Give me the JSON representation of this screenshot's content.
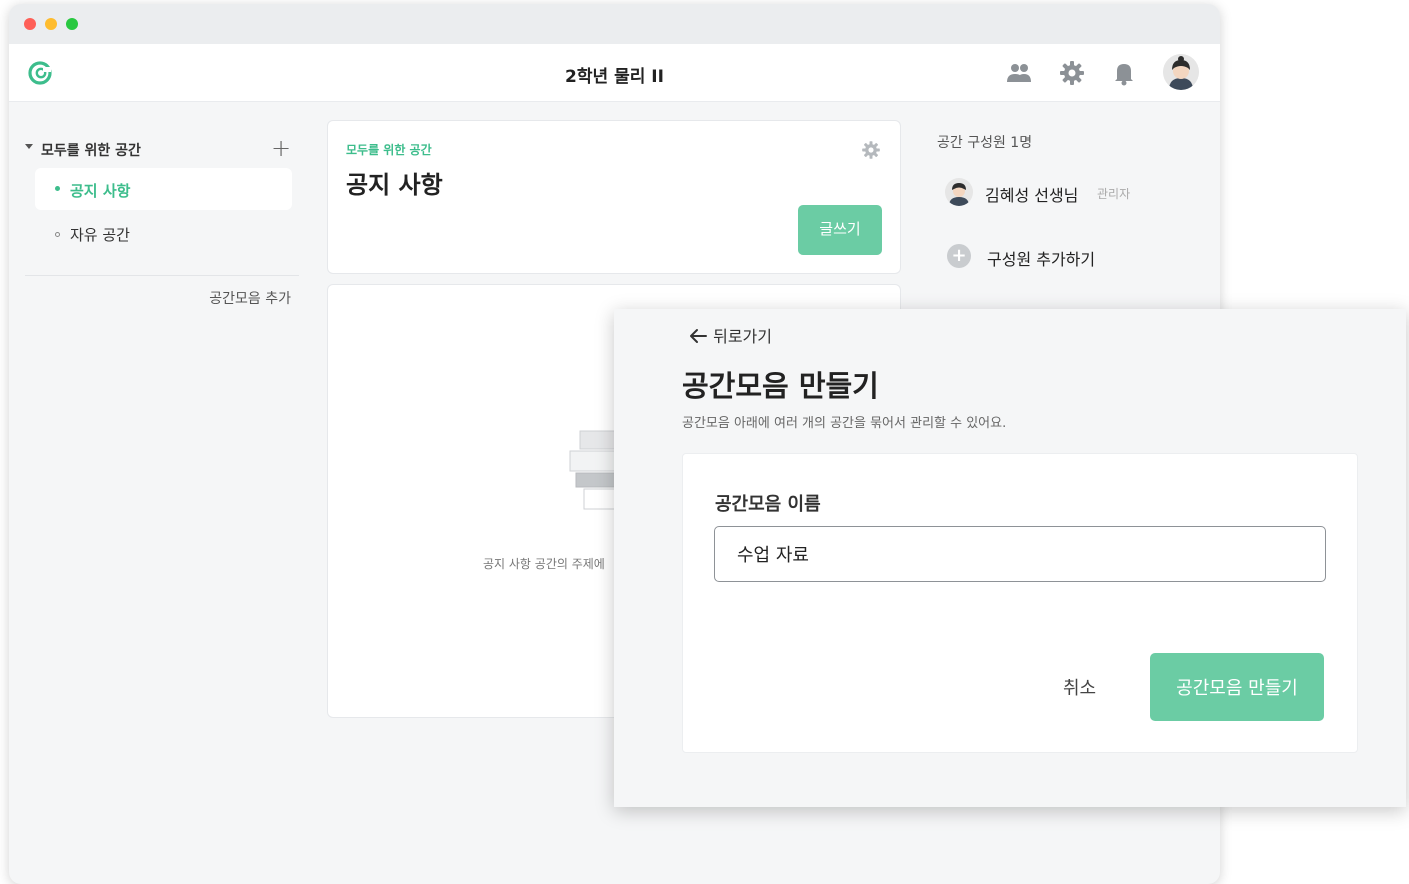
{
  "window": {
    "title": "2학년 물리 II"
  },
  "header_icons": [
    "members-icon",
    "settings-icon",
    "notification-icon",
    "user-avatar"
  ],
  "sidebar": {
    "group_title": "모두를 위한 공간",
    "items": [
      {
        "label": "공지 사항",
        "active": true
      },
      {
        "label": "자유 공간",
        "active": false
      }
    ],
    "add_collection_label": "공간모음 추가"
  },
  "main": {
    "space_group": "모두를 위한 공간",
    "space_title": "공지 사항",
    "write_button": "글쓰기",
    "empty_text": "공지 사항 공간의 주제에"
  },
  "members": {
    "count_label": "공간 구성원 1명",
    "list": [
      {
        "name": "김혜성 선생님",
        "role": "관리자"
      }
    ],
    "add_label": "구성원 추가하기"
  },
  "modal": {
    "back_label": "뒤로가기",
    "title": "공간모음 만들기",
    "description": "공간모음 아래에 여러 개의 공간을 묶어서 관리할 수 있어요.",
    "field_label": "공간모음 이름",
    "field_value": "수업 자료",
    "cancel_label": "취소",
    "create_label": "공간모음 만들기"
  },
  "colors": {
    "accent": "#3dbd8c",
    "button_green": "#6bcca4"
  }
}
